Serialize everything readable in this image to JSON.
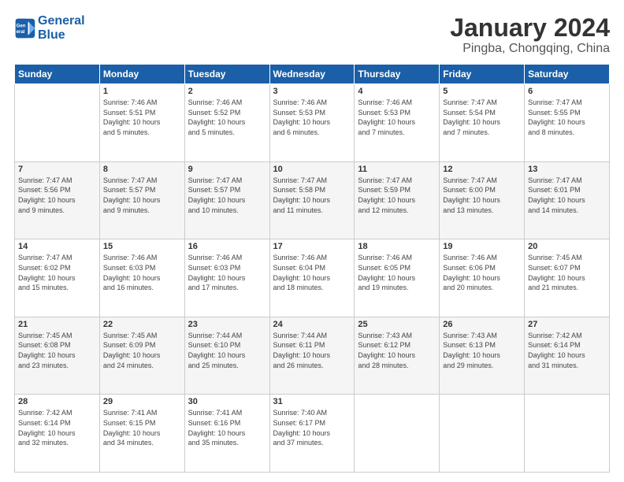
{
  "header": {
    "logo_line1": "General",
    "logo_line2": "Blue",
    "title": "January 2024",
    "subtitle": "Pingba, Chongqing, China"
  },
  "weekdays": [
    "Sunday",
    "Monday",
    "Tuesday",
    "Wednesday",
    "Thursday",
    "Friday",
    "Saturday"
  ],
  "weeks": [
    [
      {
        "day": "",
        "info": ""
      },
      {
        "day": "1",
        "info": "Sunrise: 7:46 AM\nSunset: 5:51 PM\nDaylight: 10 hours\nand 5 minutes."
      },
      {
        "day": "2",
        "info": "Sunrise: 7:46 AM\nSunset: 5:52 PM\nDaylight: 10 hours\nand 5 minutes."
      },
      {
        "day": "3",
        "info": "Sunrise: 7:46 AM\nSunset: 5:53 PM\nDaylight: 10 hours\nand 6 minutes."
      },
      {
        "day": "4",
        "info": "Sunrise: 7:46 AM\nSunset: 5:53 PM\nDaylight: 10 hours\nand 7 minutes."
      },
      {
        "day": "5",
        "info": "Sunrise: 7:47 AM\nSunset: 5:54 PM\nDaylight: 10 hours\nand 7 minutes."
      },
      {
        "day": "6",
        "info": "Sunrise: 7:47 AM\nSunset: 5:55 PM\nDaylight: 10 hours\nand 8 minutes."
      }
    ],
    [
      {
        "day": "7",
        "info": "Sunrise: 7:47 AM\nSunset: 5:56 PM\nDaylight: 10 hours\nand 9 minutes."
      },
      {
        "day": "8",
        "info": "Sunrise: 7:47 AM\nSunset: 5:57 PM\nDaylight: 10 hours\nand 9 minutes."
      },
      {
        "day": "9",
        "info": "Sunrise: 7:47 AM\nSunset: 5:57 PM\nDaylight: 10 hours\nand 10 minutes."
      },
      {
        "day": "10",
        "info": "Sunrise: 7:47 AM\nSunset: 5:58 PM\nDaylight: 10 hours\nand 11 minutes."
      },
      {
        "day": "11",
        "info": "Sunrise: 7:47 AM\nSunset: 5:59 PM\nDaylight: 10 hours\nand 12 minutes."
      },
      {
        "day": "12",
        "info": "Sunrise: 7:47 AM\nSunset: 6:00 PM\nDaylight: 10 hours\nand 13 minutes."
      },
      {
        "day": "13",
        "info": "Sunrise: 7:47 AM\nSunset: 6:01 PM\nDaylight: 10 hours\nand 14 minutes."
      }
    ],
    [
      {
        "day": "14",
        "info": "Sunrise: 7:47 AM\nSunset: 6:02 PM\nDaylight: 10 hours\nand 15 minutes."
      },
      {
        "day": "15",
        "info": "Sunrise: 7:46 AM\nSunset: 6:03 PM\nDaylight: 10 hours\nand 16 minutes."
      },
      {
        "day": "16",
        "info": "Sunrise: 7:46 AM\nSunset: 6:03 PM\nDaylight: 10 hours\nand 17 minutes."
      },
      {
        "day": "17",
        "info": "Sunrise: 7:46 AM\nSunset: 6:04 PM\nDaylight: 10 hours\nand 18 minutes."
      },
      {
        "day": "18",
        "info": "Sunrise: 7:46 AM\nSunset: 6:05 PM\nDaylight: 10 hours\nand 19 minutes."
      },
      {
        "day": "19",
        "info": "Sunrise: 7:46 AM\nSunset: 6:06 PM\nDaylight: 10 hours\nand 20 minutes."
      },
      {
        "day": "20",
        "info": "Sunrise: 7:45 AM\nSunset: 6:07 PM\nDaylight: 10 hours\nand 21 minutes."
      }
    ],
    [
      {
        "day": "21",
        "info": "Sunrise: 7:45 AM\nSunset: 6:08 PM\nDaylight: 10 hours\nand 23 minutes."
      },
      {
        "day": "22",
        "info": "Sunrise: 7:45 AM\nSunset: 6:09 PM\nDaylight: 10 hours\nand 24 minutes."
      },
      {
        "day": "23",
        "info": "Sunrise: 7:44 AM\nSunset: 6:10 PM\nDaylight: 10 hours\nand 25 minutes."
      },
      {
        "day": "24",
        "info": "Sunrise: 7:44 AM\nSunset: 6:11 PM\nDaylight: 10 hours\nand 26 minutes."
      },
      {
        "day": "25",
        "info": "Sunrise: 7:43 AM\nSunset: 6:12 PM\nDaylight: 10 hours\nand 28 minutes."
      },
      {
        "day": "26",
        "info": "Sunrise: 7:43 AM\nSunset: 6:13 PM\nDaylight: 10 hours\nand 29 minutes."
      },
      {
        "day": "27",
        "info": "Sunrise: 7:42 AM\nSunset: 6:14 PM\nDaylight: 10 hours\nand 31 minutes."
      }
    ],
    [
      {
        "day": "28",
        "info": "Sunrise: 7:42 AM\nSunset: 6:14 PM\nDaylight: 10 hours\nand 32 minutes."
      },
      {
        "day": "29",
        "info": "Sunrise: 7:41 AM\nSunset: 6:15 PM\nDaylight: 10 hours\nand 34 minutes."
      },
      {
        "day": "30",
        "info": "Sunrise: 7:41 AM\nSunset: 6:16 PM\nDaylight: 10 hours\nand 35 minutes."
      },
      {
        "day": "31",
        "info": "Sunrise: 7:40 AM\nSunset: 6:17 PM\nDaylight: 10 hours\nand 37 minutes."
      },
      {
        "day": "",
        "info": ""
      },
      {
        "day": "",
        "info": ""
      },
      {
        "day": "",
        "info": ""
      }
    ]
  ]
}
